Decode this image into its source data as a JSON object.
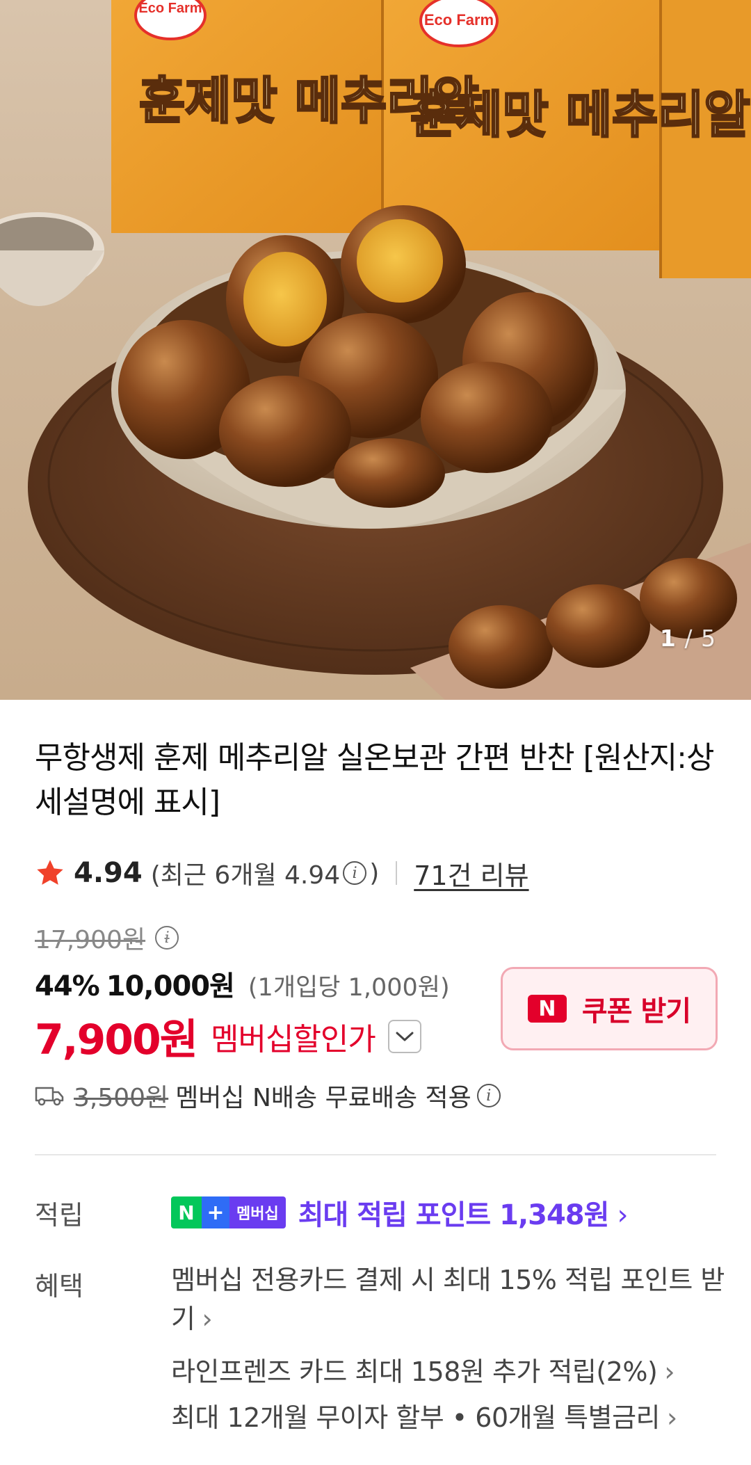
{
  "gallery": {
    "current": "1",
    "separator": "/",
    "total": "5",
    "package_brand": "Eco Farm",
    "package_name": "훈제맛 메추리알"
  },
  "product": {
    "title": "무항생제 훈제 메추리알 실온보관 간편 반찬 [원산지:상세설명에 표시]"
  },
  "rating": {
    "score": "4.94",
    "recent_label": "(최근 6개월 4.94",
    "recent_close": ")",
    "reviews": "71건 리뷰",
    "info_icon": "i"
  },
  "price": {
    "original": "17,900원",
    "discount_pct": "44%",
    "sale": "10,000원",
    "unit_price": "(1개입당 1,000원)",
    "member_price": "7,900원",
    "member_label": "멤버십할인가"
  },
  "coupon": {
    "badge": "N",
    "label": "쿠폰 받기"
  },
  "shipping": {
    "old_fee": "3,500원",
    "text": "멤버십 N배송 무료배송 적용"
  },
  "points": {
    "label": "적립",
    "badge_n": "N",
    "badge_plus": "+",
    "badge_text": "멤버십",
    "text": "최대 적립 포인트 1,348원",
    "arrow": "›"
  },
  "benefits": {
    "label": "혜택",
    "items": [
      {
        "text": "멤버십 전용카드 결제 시 최대 15% 적립 포인트 받기",
        "arrow": "›"
      },
      {
        "text": "라인프렌즈 카드 최대 158원 추가 적립(2%)",
        "arrow": "›"
      },
      {
        "text": "최대 12개월 무이자 할부 • 60개월 특별금리",
        "arrow": "›"
      }
    ]
  },
  "colors": {
    "accent_red": "#e3002b",
    "membership_purple": "#6a3cf0",
    "naver_green": "#03c75a"
  }
}
